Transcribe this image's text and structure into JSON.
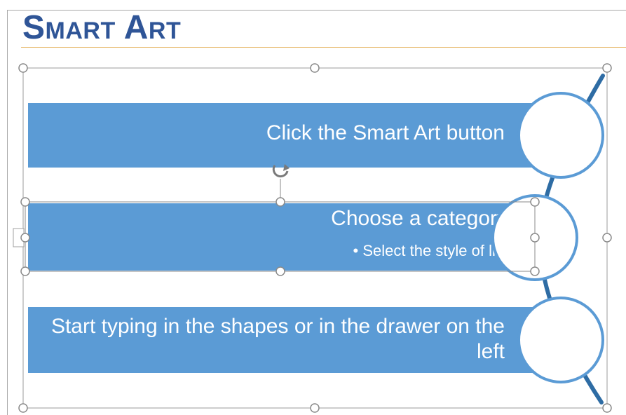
{
  "slide": {
    "title": "Smart Art"
  },
  "smartart": {
    "items": [
      {
        "text": "Click the Smart Art button"
      },
      {
        "text": "Choose a category",
        "bullet": "• Select the style of list"
      },
      {
        "text": "Start typing in the shapes or in the drawer on the left"
      }
    ]
  },
  "colors": {
    "title": "#2f5597",
    "bar_fill": "#5b9bd5",
    "circle_stroke": "#5b9bd5",
    "connector": "#2e6ca4",
    "accent_rule": "#e7b96a"
  },
  "icons": {
    "rotate": "rotate-handle-icon"
  }
}
